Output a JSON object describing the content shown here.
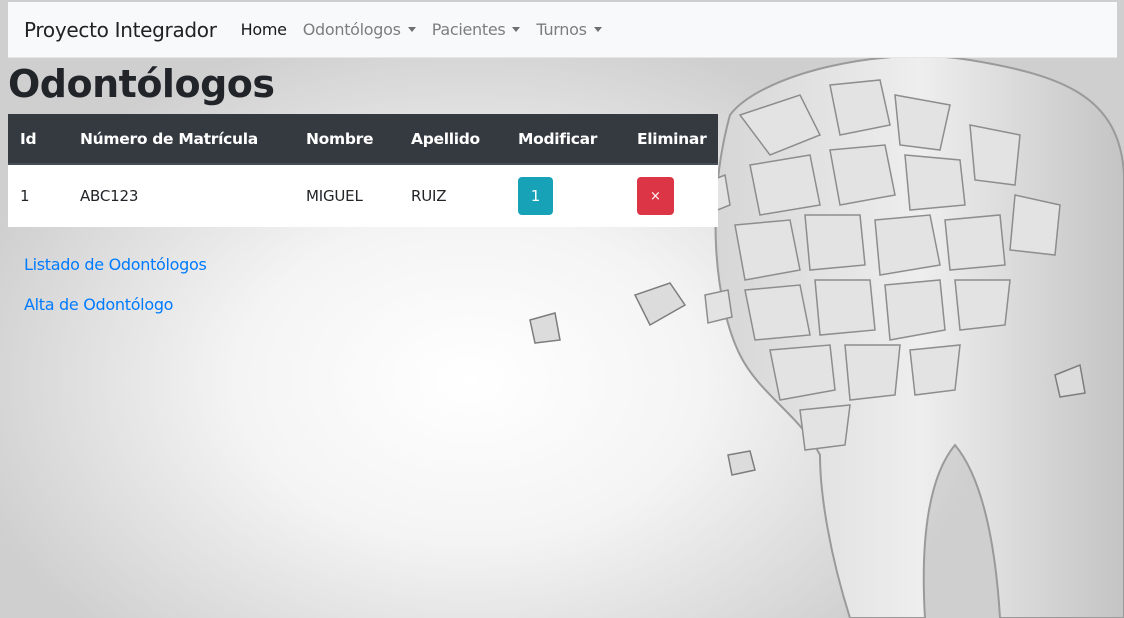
{
  "navbar": {
    "brand": "Proyecto Integrador",
    "items": [
      {
        "label": "Home",
        "dropdown": false,
        "active": true
      },
      {
        "label": "Odontólogos",
        "dropdown": true,
        "active": false
      },
      {
        "label": "Pacientes",
        "dropdown": true,
        "active": false
      },
      {
        "label": "Turnos",
        "dropdown": true,
        "active": false
      }
    ]
  },
  "page": {
    "title": "Odontólogos"
  },
  "table": {
    "headers": [
      "Id",
      "Número de Matrícula",
      "Nombre",
      "Apellido",
      "Modificar",
      "Eliminar"
    ],
    "rows": [
      {
        "id": "1",
        "matricula": "ABC123",
        "nombre": "MIGUEL",
        "apellido": "RUIZ",
        "modify_label": "1",
        "delete_label": "×"
      }
    ]
  },
  "links": {
    "listado": "Listado de Odontólogos",
    "alta": "Alta de Odontólogo"
  },
  "colors": {
    "navbar_bg": "#f8f9fa",
    "table_head_bg": "#343a40",
    "info": "#17a2b8",
    "danger": "#dc3545",
    "link": "#007bff"
  }
}
